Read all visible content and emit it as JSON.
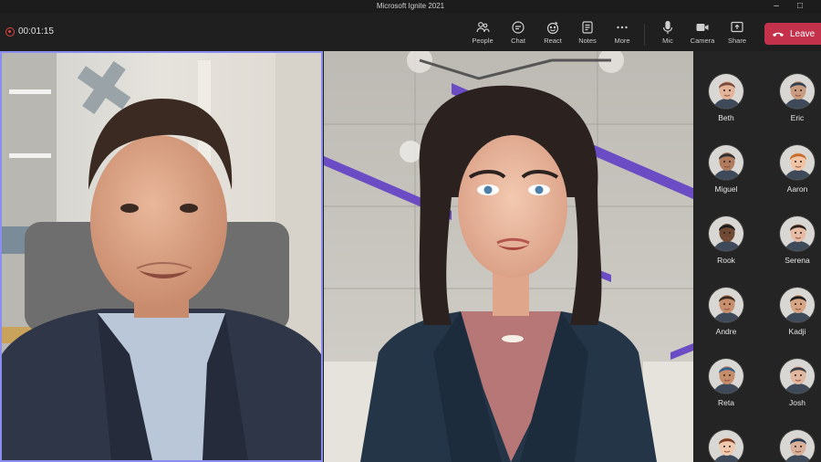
{
  "window": {
    "title": "Microsoft Ignite 2021"
  },
  "meeting": {
    "timer": "00:01:15"
  },
  "toolbar": {
    "items": [
      {
        "label": "People",
        "icon": "people-icon"
      },
      {
        "label": "Chat",
        "icon": "chat-icon"
      },
      {
        "label": "React",
        "icon": "react-icon"
      },
      {
        "label": "Notes",
        "icon": "notes-icon"
      },
      {
        "label": "More",
        "icon": "more-icon"
      },
      {
        "label": "Mic",
        "icon": "mic-icon"
      },
      {
        "label": "Camera",
        "icon": "camera-icon"
      },
      {
        "label": "Share",
        "icon": "share-icon"
      }
    ],
    "leave_label": "Leave"
  },
  "participants": [
    {
      "name": "Beth"
    },
    {
      "name": "Eric"
    },
    {
      "name": "Miguel"
    },
    {
      "name": "Aaron"
    },
    {
      "name": "Rook"
    },
    {
      "name": "Serena"
    },
    {
      "name": "Andre"
    },
    {
      "name": "Kadji"
    },
    {
      "name": "Reta"
    },
    {
      "name": "Josh"
    },
    {
      "name": ""
    },
    {
      "name": ""
    }
  ],
  "colors": {
    "accent": "#8b8df0",
    "leave": "#c4314b",
    "background": "#1f1f1f"
  }
}
